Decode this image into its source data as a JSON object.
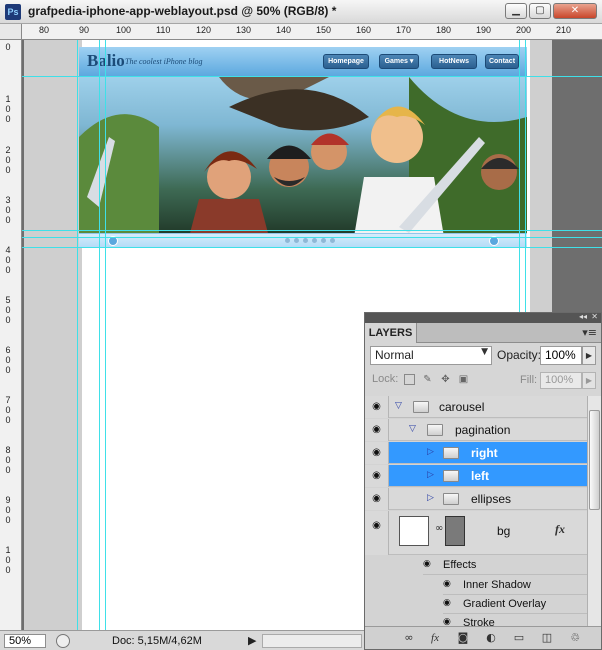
{
  "window": {
    "app_icon_text": "Ps",
    "title": "grafpedia-iphone-app-weblayout.psd @ 50% (RGB/8) *",
    "controls": [
      "▁",
      "▢",
      "✕"
    ]
  },
  "ruler_top": [
    "80",
    "90",
    "100",
    "110",
    "120",
    "130",
    "140",
    "150",
    "160",
    "170",
    "180",
    "190",
    "200",
    "210"
  ],
  "ruler_left": [
    "0",
    "1 0 0",
    "2 0 0",
    "3 0 0",
    "4 0 0",
    "5 0 0",
    "6 0 0",
    "7 0 0",
    "8 0 0",
    "9 0 0",
    "1 0 0"
  ],
  "mockup": {
    "logo": "Balio",
    "tagline": "The coolest iPhone blog",
    "nav": [
      "Homepage",
      "Games ▾",
      "HotNews",
      "Contact"
    ]
  },
  "status": {
    "zoom": "50%",
    "doc": "Doc: 5,15M/4,62M",
    "arrow": "▶"
  },
  "layers_panel": {
    "tab": "LAYERS",
    "blend_mode": "Normal",
    "opacity_label": "Opacity:",
    "opacity": "100%",
    "lock_label": "Lock:",
    "fill_label": "Fill:",
    "fill": "100%",
    "layers": [
      {
        "name": "carousel",
        "expanded": true,
        "selected": false
      },
      {
        "name": "pagination",
        "expanded": true,
        "selected": false
      },
      {
        "name": "right",
        "expanded": false,
        "selected": true
      },
      {
        "name": "left",
        "expanded": false,
        "selected": true
      },
      {
        "name": "ellipses",
        "expanded": false,
        "selected": false
      }
    ],
    "bg_layer": {
      "name": "bg",
      "fx": "fx"
    },
    "effects_label": "Effects",
    "effects": [
      "Inner Shadow",
      "Gradient Overlay",
      "Stroke"
    ]
  },
  "colors": {
    "selection": "#3399ff",
    "guides": "#3fe0e8"
  }
}
